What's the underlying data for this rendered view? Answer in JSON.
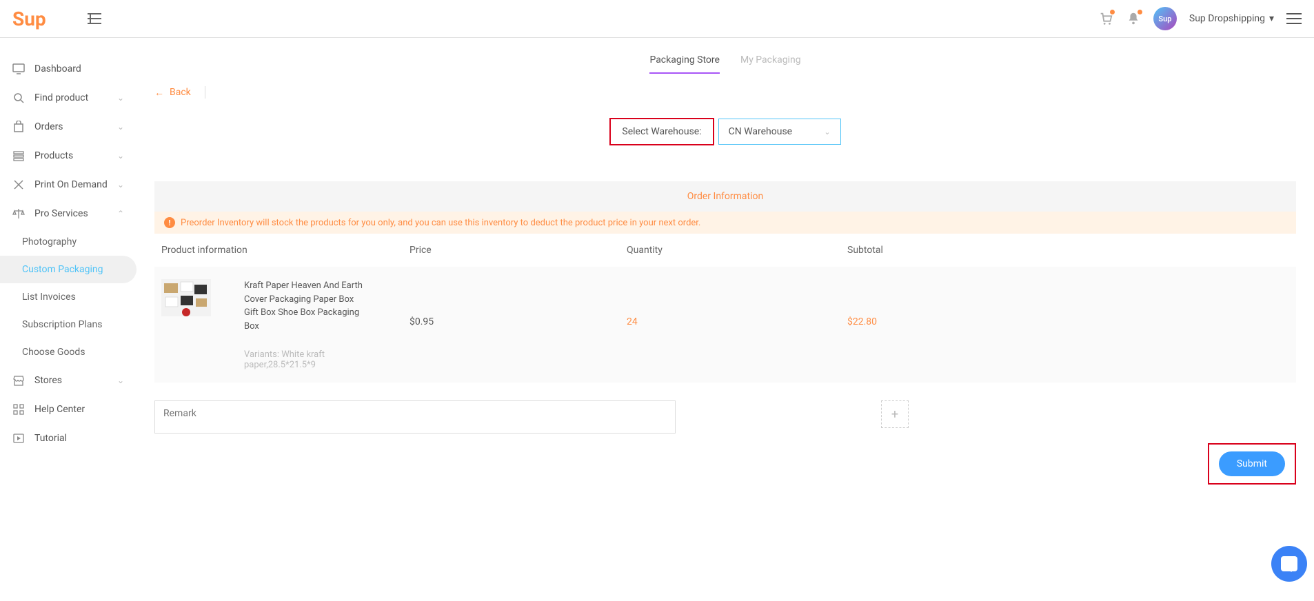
{
  "header": {
    "logo": "Sup",
    "user_label": "Sup Dropshipping",
    "avatar_text": "Sup"
  },
  "sidebar": {
    "items": [
      {
        "label": "Dashboard",
        "expandable": false
      },
      {
        "label": "Find product",
        "expandable": true
      },
      {
        "label": "Orders",
        "expandable": true
      },
      {
        "label": "Products",
        "expandable": true
      },
      {
        "label": "Print On Demand",
        "expandable": true
      },
      {
        "label": "Pro Services",
        "expandable": true,
        "open": true
      },
      {
        "label": "Stores",
        "expandable": true
      },
      {
        "label": "Help Center",
        "expandable": false
      },
      {
        "label": "Tutorial",
        "expandable": false
      }
    ],
    "pro_services_sub": [
      {
        "label": "Photography"
      },
      {
        "label": "Custom Packaging"
      },
      {
        "label": "List Invoices"
      },
      {
        "label": "Subscription Plans"
      },
      {
        "label": "Choose Goods"
      }
    ],
    "active_sub": "Custom Packaging"
  },
  "tabs": {
    "active": "Packaging Store",
    "inactive": "My Packaging"
  },
  "back_label": "Back",
  "warehouse": {
    "label": "Select Warehouse:",
    "value": "CN Warehouse"
  },
  "order_info_title": "Order Information",
  "alert_text": "Preorder Inventory will stock the products for you only, and you can use this inventory to deduct the product price in your next order.",
  "table": {
    "headers": {
      "product": "Product information",
      "price": "Price",
      "quantity": "Quantity",
      "subtotal": "Subtotal"
    },
    "row": {
      "name": "Kraft Paper Heaven And Earth Cover Packaging Paper Box Gift Box Shoe Box Packaging Box",
      "variants_label": "Variants:",
      "variants_value": "White kraft paper,28.5*21.5*9",
      "price": "$0.95",
      "quantity": "24",
      "subtotal": "$22.80"
    }
  },
  "remark_placeholder": "Remark",
  "submit_label": "Submit"
}
